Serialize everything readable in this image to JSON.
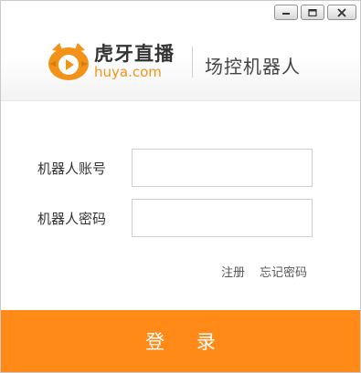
{
  "window": {
    "controls": [
      {
        "name": "minimize",
        "icon": "minimize-icon"
      },
      {
        "name": "maximize",
        "icon": "maximize-icon"
      },
      {
        "name": "close",
        "icon": "close-icon"
      }
    ]
  },
  "header": {
    "logo_icon": "huya-tiger-logo",
    "brand_cn": "虎牙直播",
    "brand_en": "huya.com",
    "app_title": "场控机器人"
  },
  "form": {
    "account_label": "机器人账号",
    "account_value": "",
    "password_label": "机器人密码",
    "password_value": ""
  },
  "links": {
    "register": "注册",
    "forgot_password": "忘记密码"
  },
  "login": {
    "label": "登 录"
  },
  "colors": {
    "accent": "#ff8a18",
    "brand_orange": "#f39219",
    "text": "#333333"
  }
}
